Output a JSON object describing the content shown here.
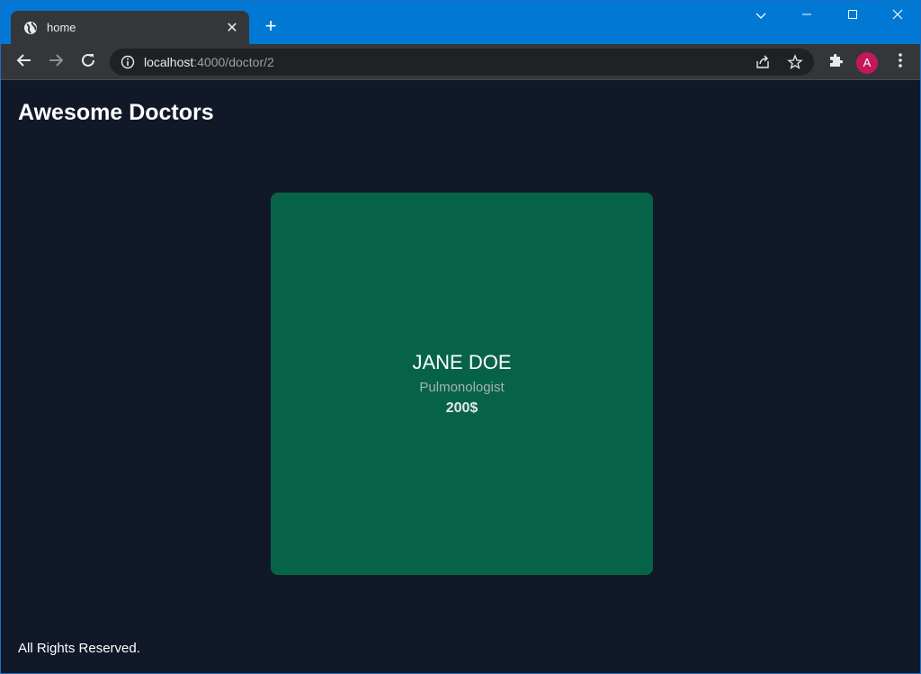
{
  "browser": {
    "tab_title": "home",
    "new_tab_symbol": "+",
    "tab_close_symbol": "✕",
    "url_host": "localhost",
    "url_rest": ":4000/doctor/2",
    "avatar_letter": "A",
    "accent_color": "#0078d4"
  },
  "site": {
    "title": "Awesome Doctors",
    "footer": "All Rights Reserved."
  },
  "doctor": {
    "name": "JANE DOE",
    "specialty": "Pulmonologist",
    "price": "200$",
    "card_color": "#066348"
  }
}
